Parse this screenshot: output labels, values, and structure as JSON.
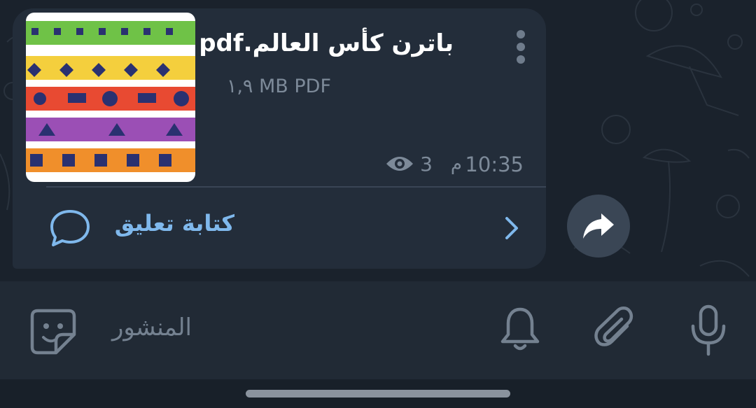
{
  "message": {
    "file_title": "باترن كأس العالم.pdf",
    "file_meta": "١,٩ MB PDF",
    "time": "10:35",
    "time_suffix": "م",
    "views": "3",
    "comment_label": "كتابة تعليق"
  },
  "composer": {
    "placeholder": "المنشور"
  },
  "icons": {
    "more": "more-vertical-icon",
    "views": "eye-icon",
    "comment": "comment-bubble-icon",
    "chevron": "chevron-right-icon",
    "share": "share-forward-icon",
    "sticker": "sticker-icon",
    "bell": "bell-icon",
    "attach": "paperclip-icon",
    "mic": "microphone-icon"
  },
  "colors": {
    "chat_background": "#1a222c",
    "bubble": "#232d3a",
    "accent_link": "#7fb8ec",
    "muted_text": "#7d8a99",
    "input_bar": "#212a35",
    "thumbnail_stripes": [
      "#6fc247",
      "#f4cf3d",
      "#e84a32",
      "#9b4fb5",
      "#f08f2b"
    ]
  }
}
